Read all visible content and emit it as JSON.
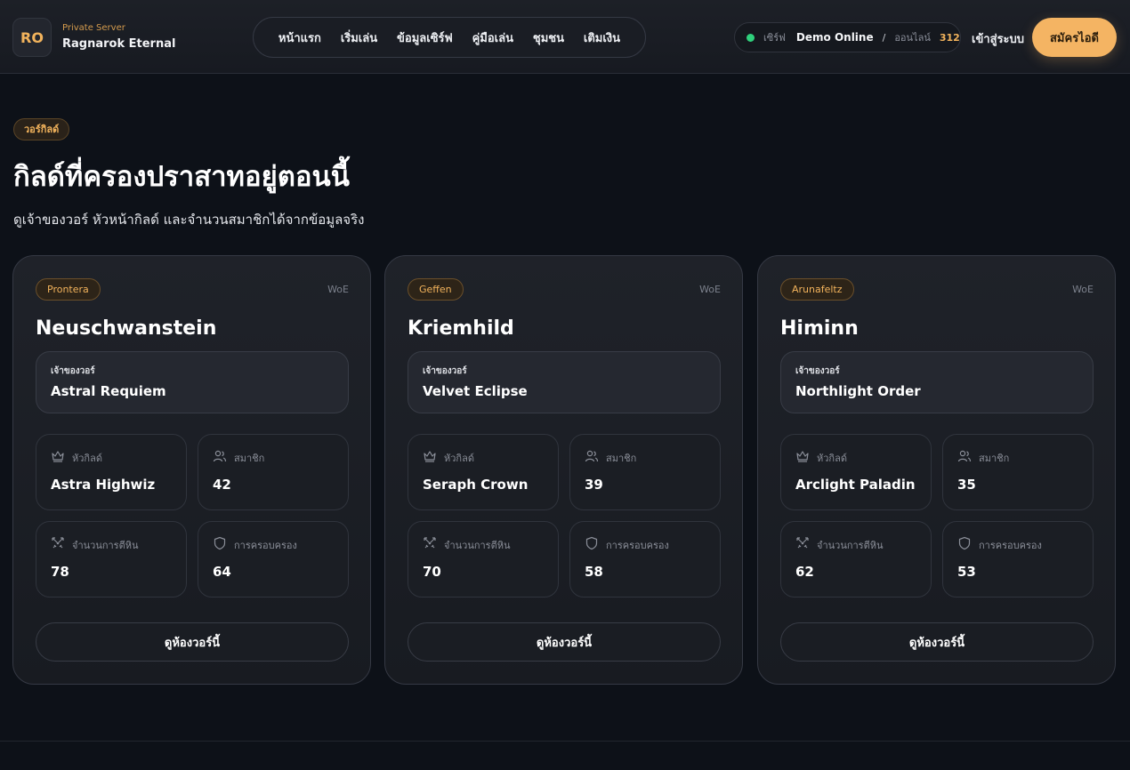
{
  "brand": {
    "logo": "RO",
    "subtitle": "Private Server",
    "title": "Ragnarok Eternal"
  },
  "nav": [
    "หน้าแรก",
    "เริ่มเล่น",
    "ข้อมูลเซิร์ฟ",
    "คู่มือเล่น",
    "ชุมชน",
    "เติมเงิน"
  ],
  "status": {
    "server_label": "เซิร์ฟ",
    "server_value": "Demo Online",
    "separator": "/",
    "online_label": "ออนไลน์",
    "online_count": "312",
    "dot_color": "#2fd07c"
  },
  "auth": {
    "login": "เข้าสู่ระบบ",
    "register": "สมัครไอดี"
  },
  "section": {
    "badge": "วอร์กิลด์",
    "title": "กิลด์ที่ครองปราสาทอยู่ตอนนี้",
    "subtitle": "ดูเจ้าของวอร์ หัวหน้ากิลด์ และจำนวนสมาชิกได้จากข้อมูลจริง"
  },
  "labels": {
    "woe": "WoE",
    "owner": "เจ้าของวอร์",
    "leader": "หัวกิลด์",
    "members": "สมาชิก",
    "kills": "จำนวนการตีหิน",
    "holdings": "การครอบครอง",
    "view_button": "ดูห้องวอร์นี้"
  },
  "cards": [
    {
      "city": "Prontera",
      "castle": "Neuschwanstein",
      "owner": "Astral Requiem",
      "leader": "Astra Highwiz",
      "members": "42",
      "kills": "78",
      "holdings": "64"
    },
    {
      "city": "Geffen",
      "castle": "Kriemhild",
      "owner": "Velvet Eclipse",
      "leader": "Seraph Crown",
      "members": "39",
      "kills": "70",
      "holdings": "58"
    },
    {
      "city": "Arunafeltz",
      "castle": "Himinn",
      "owner": "Northlight Order",
      "leader": "Arclight Paladin",
      "members": "35",
      "kills": "62",
      "holdings": "53"
    }
  ],
  "colors": {
    "accent": "#f4b463",
    "background": "#0d1118"
  },
  "icons": {
    "leader": "crown-icon",
    "members": "users-icon",
    "kills": "swords-icon",
    "holdings": "shield-icon"
  }
}
